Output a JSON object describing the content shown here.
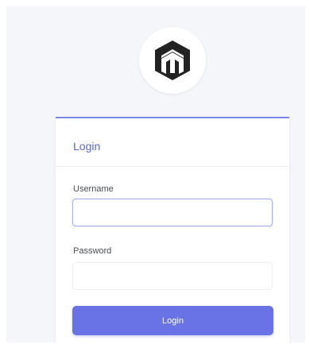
{
  "brand": {
    "logo_icon": "mikrotik-logo-icon",
    "logo_color": "#222222"
  },
  "login_card": {
    "title": "Login",
    "username_label": "Username",
    "username_value": "",
    "username_placeholder": "",
    "password_label": "Password",
    "password_value": "",
    "password_placeholder": "",
    "submit_label": "Login"
  },
  "colors": {
    "accent": "#6a73e6",
    "title": "#5a66d6",
    "background": "#f4f6f9"
  }
}
